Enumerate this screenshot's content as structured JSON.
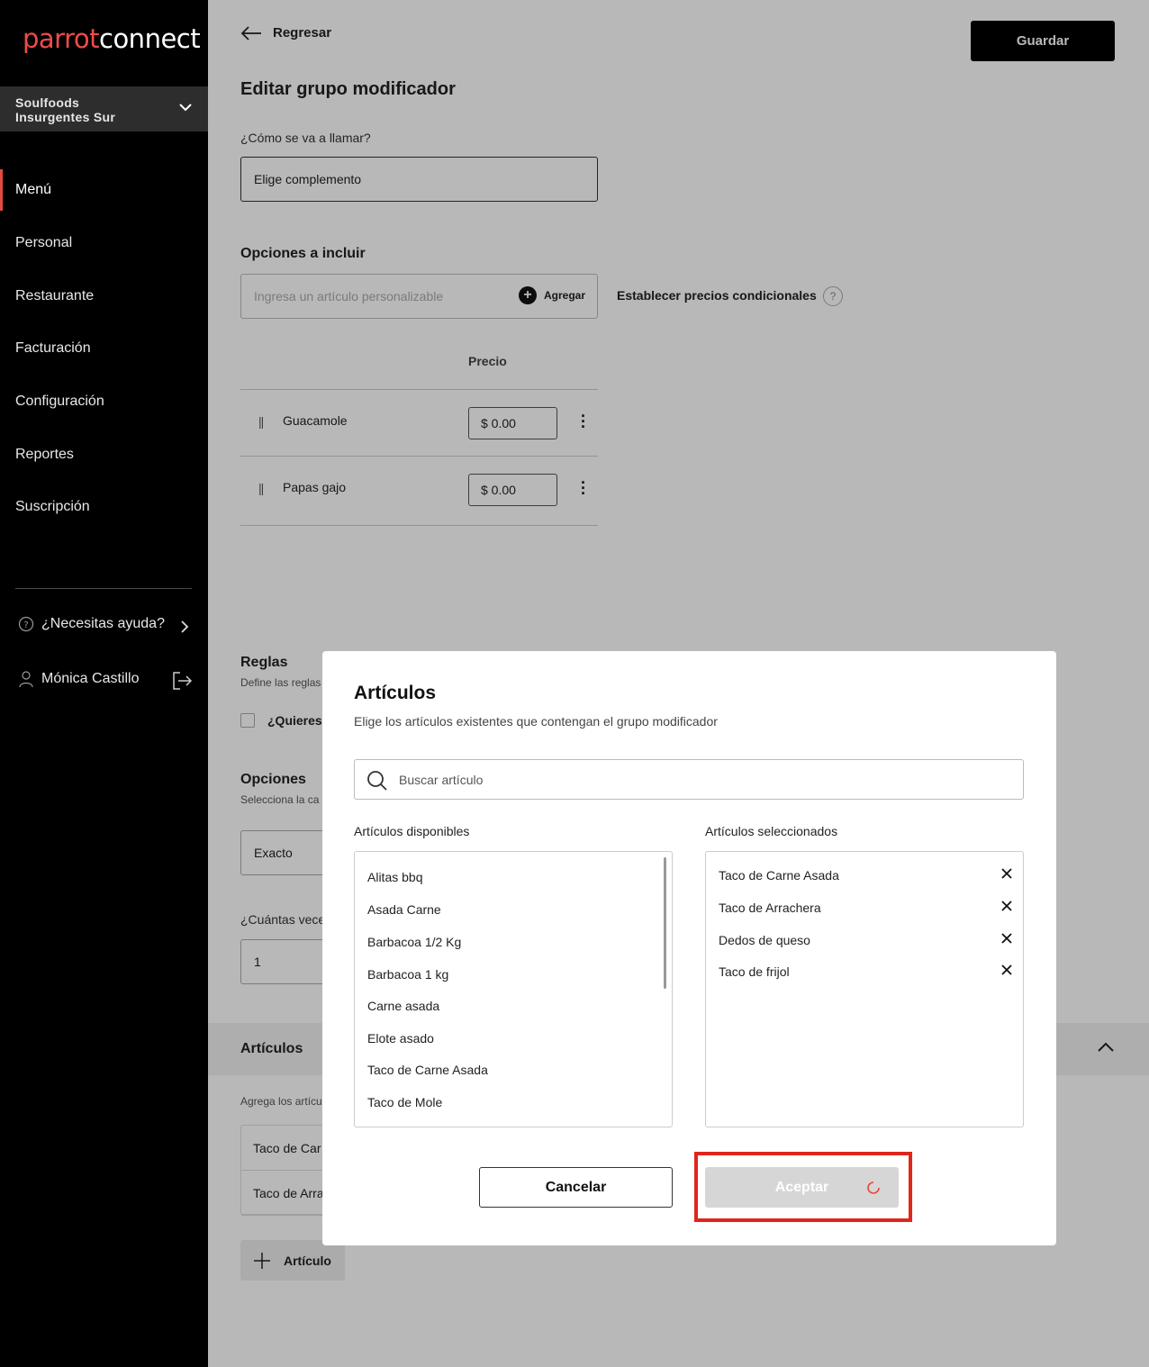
{
  "sidebar": {
    "logo_a": "parrot",
    "logo_b": "connect",
    "store_name": "Soulfoods\nInsurgentes Sur",
    "items": [
      {
        "label": "Menú",
        "active": true
      },
      {
        "label": "Personal"
      },
      {
        "label": "Restaurante"
      },
      {
        "label": "Facturación"
      },
      {
        "label": "Configuración"
      },
      {
        "label": "Reportes"
      },
      {
        "label": "Suscripción"
      }
    ],
    "help": "¿Necesitas ayuda?",
    "user": "Mónica Castillo",
    "accent_color": "#e5483f"
  },
  "header": {
    "back_label": "Regresar",
    "save_label": "Guardar"
  },
  "form": {
    "title": "Editar grupo modificador",
    "name_label": "¿Cómo se va a llamar?",
    "name_value": "Elige complemento",
    "options_title": "Opciones a incluir",
    "options_placeholder": "Ingresa un artículo personalizable",
    "add_label": "Agregar",
    "conditional_label": "Establecer precios condicionales",
    "price_header": "Precio",
    "options": [
      {
        "name": "Guacamole",
        "price": "$ 0.00"
      },
      {
        "name": "Papas gajo",
        "price": "$ 0.00"
      }
    ],
    "rules_title": "Reglas",
    "rules_sub": "Define las reglas",
    "rules_question": "¿Quieres",
    "opciones_title": "Opciones",
    "opciones_sub": "Selecciona la ca",
    "exact_value": "Exacto",
    "how_many_label": "¿Cuántas vece",
    "how_many_value": "1",
    "articles_title": "Artículos",
    "articles_sub": "Agrega los artícu",
    "articles": [
      "Taco de Car",
      "Taco de Arra"
    ],
    "add_article": "Artículo"
  },
  "modal": {
    "title": "Artículos",
    "subtitle": "Elige los artículos existentes que contengan el grupo modificador",
    "search_placeholder": "Buscar artículo",
    "available_title": "Artículos disponibles",
    "selected_title": "Artículos seleccionados",
    "available": [
      "Alitas bbq",
      "Asada Carne",
      "Barbacoa 1/2 Kg",
      "Barbacoa 1 kg",
      "Carne asada",
      "Elote asado",
      "Taco de Carne Asada",
      "Taco de Mole"
    ],
    "selected": [
      "Taco de Carne Asada",
      "Taco de Arrachera",
      "Dedos de queso",
      "Taco de frijol"
    ],
    "cancel_label": "Cancelar",
    "accept_label": "Aceptar",
    "highlight_color": "#e0261b"
  }
}
